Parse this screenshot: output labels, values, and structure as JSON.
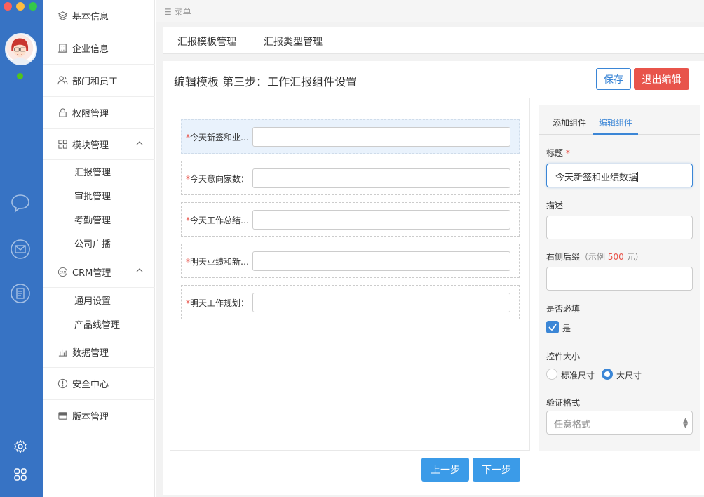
{
  "topbar": {
    "label": "☰ 菜单"
  },
  "sidebar": {
    "items": [
      {
        "label": "基本信息",
        "icon": "layers-icon"
      },
      {
        "label": "企业信息",
        "icon": "building-icon"
      },
      {
        "label": "部门和员工",
        "icon": "users-icon"
      },
      {
        "label": "权限管理",
        "icon": "lock-icon"
      },
      {
        "label": "模块管理",
        "icon": "grid-icon"
      },
      {
        "label": "CRM管理",
        "icon": "crm-icon"
      },
      {
        "label": "数据管理",
        "icon": "bar-chart-icon"
      },
      {
        "label": "安全中心",
        "icon": "alert-icon"
      },
      {
        "label": "版本管理",
        "icon": "version-icon"
      }
    ],
    "module_sub": [
      "汇报管理",
      "审批管理",
      "考勤管理",
      "公司广播"
    ],
    "crm_sub": [
      "通用设置",
      "产品线管理"
    ]
  },
  "tabs": [
    "汇报模板管理",
    "汇报类型管理"
  ],
  "card": {
    "title": "编辑模板 第三步：工作汇报组件设置",
    "save": "保存",
    "exit": "退出编辑"
  },
  "fields": [
    {
      "req": "*",
      "label": "今天新签和业…"
    },
    {
      "req": "*",
      "label": "今天意向家数："
    },
    {
      "req": "*",
      "label": "今天工作总结…"
    },
    {
      "req": "*",
      "label": "明天业绩和新…"
    },
    {
      "req": "*",
      "label": "明天工作规划："
    }
  ],
  "buttons": {
    "prev": "上一步",
    "next": "下一步"
  },
  "panel": {
    "tab_add": "添加组件",
    "tab_edit": "编辑组件",
    "title_label": "标题",
    "title_req": "*",
    "title_value": "今天新签和业绩数据",
    "desc_label": "描述",
    "suffix_label": "右侧后缀",
    "suffix_hint_pre": "（示例 ",
    "suffix_hint_num": "500",
    "suffix_hint_post": " 元）",
    "required_label": "是否必填",
    "required_option": "是",
    "size_label": "控件大小",
    "size_standard": "标准尺寸",
    "size_large": "大尺寸",
    "validate_label": "验证格式",
    "validate_value": "任意格式"
  },
  "colors": {
    "rail": "#3773c4",
    "accent": "#3b86d6",
    "danger": "#e8544b",
    "step": "#3b9be8"
  }
}
